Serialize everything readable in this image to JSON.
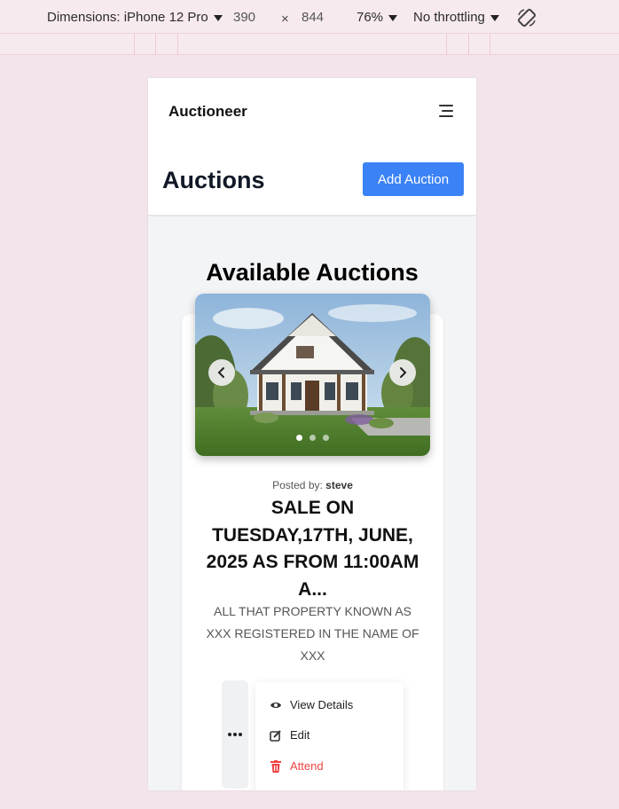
{
  "devtools": {
    "device_label": "Dimensions: iPhone 12 Pro",
    "width": "390",
    "times": "×",
    "height": "844",
    "zoom": "76%",
    "throttling": "No throttling",
    "rotate_icon": "rotate-icon"
  },
  "navbar": {
    "brand": "Auctioneer",
    "menu_icon": "hamburger-menu-icon"
  },
  "header": {
    "title": "Auctions",
    "add_button": "Add Auction"
  },
  "section_title": "Available Auctions",
  "auction": {
    "carousel": {
      "slides": 3,
      "active_slide": 1,
      "prev_icon": "chevron-left-icon",
      "next_icon": "chevron-right-icon"
    },
    "posted_by_label": "Posted by:",
    "posted_by_user": "steve",
    "title": "SALE ON TUESDAY,17TH, JUNE, 2025 AS FROM 11:00AM A...",
    "description": "ALL THAT PROPERTY KNOWN AS XXX REGISTERED IN THE NAME OF XXX",
    "actions": [
      {
        "label": "View Details",
        "icon": "eye-icon"
      },
      {
        "label": "Edit",
        "icon": "edit-icon"
      },
      {
        "label": "Attend",
        "icon": "trash-icon",
        "color": "#ef4444"
      }
    ]
  },
  "colors": {
    "accent": "#3b82f6",
    "danger": "#ef4444",
    "page_bg": "#f2e4ea"
  }
}
